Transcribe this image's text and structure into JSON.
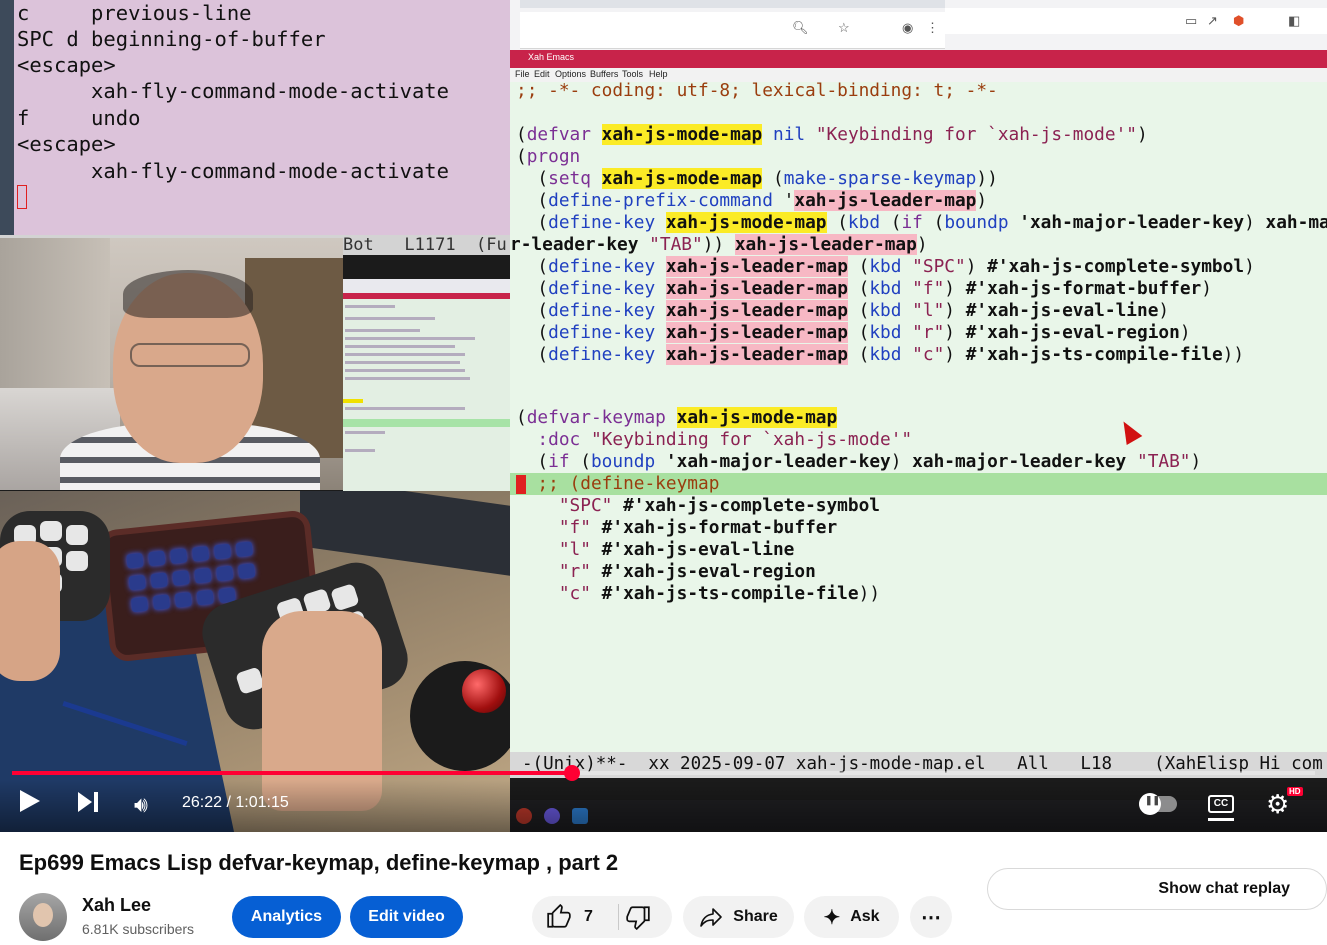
{
  "left_emacs": {
    "lines": [
      "c     previous-line",
      "SPC d beginning-of-buffer",
      "<escape>",
      "      xah-fly-command-mode-activate",
      "f     undo",
      "<escape>",
      "      xah-fly-command-mode-activate"
    ],
    "modeline": "Bot   L1171  (Fu"
  },
  "emacs": {
    "title": "Xah Emacs",
    "menu": [
      "File",
      "Edit",
      "Options",
      "Buffers",
      "Tools",
      "Help"
    ],
    "code": {
      "l1": ";; -*- coding: utf-8; lexical-binding: t; -*-",
      "defvar": "defvar",
      "mapname": "xah-js-mode-map",
      "nil": "nil",
      "docstr": "\"Keybinding for `xah-js-mode'\"",
      "progn": "progn",
      "setq": "setq",
      "make_sparse": "make-sparse-keymap",
      "define_prefix": "define-prefix-command",
      "quote": "'",
      "leader": "xah-js-leader-map",
      "define_key": "define-key",
      "kbd": "kbd",
      "if": "if",
      "boundp": "boundp",
      "major_leader_q": "'xah-major-leader-key",
      "major_leader_tail": " xah-maj",
      "wrap_line": "r-leader-key ",
      "tab": "\"TAB\"",
      "k_spc": "\"SPC\"",
      "k_f": "\"f\"",
      "k_l": "\"l\"",
      "k_r": "\"r\"",
      "k_c": "\"c\"",
      "f_complete": "#'xah-js-complete-symbol",
      "f_format": "#'xah-js-format-buffer",
      "f_evalline": "#'xah-js-eval-line",
      "f_evalregion": "#'xah-js-eval-region",
      "f_compile": "#'xah-js-ts-compile-file",
      "defvar_keymap": "defvar-keymap",
      "doc_kw": ":doc",
      "major_leader": "xah-major-leader-key",
      "cmt_define_keymap": ";; (define-keymap"
    },
    "modeline": "-(Unix)**-  xx 2025-09-07 xah-js-mode-map.el   All   L18    (XahElisp Hi com"
  },
  "player": {
    "time": "26:22 / 1:01:15",
    "progress_fraction": 0.43,
    "cc": "CC",
    "hd": "HD"
  },
  "video": {
    "title": "Ep699 Emacs Lisp defvar-keymap, define-keymap , part 2"
  },
  "channel": {
    "name": "Xah Lee",
    "subscribers": "6.81K subscribers"
  },
  "actions": {
    "analytics": "Analytics",
    "edit": "Edit video",
    "likes": "7",
    "share": "Share",
    "ask": "Ask",
    "more": "⋯",
    "chat_replay": "Show chat replay"
  },
  "colors": {
    "accent_red": "#ff0033",
    "brand_blue": "#065fd4",
    "emacs_title": "#c8234a"
  }
}
